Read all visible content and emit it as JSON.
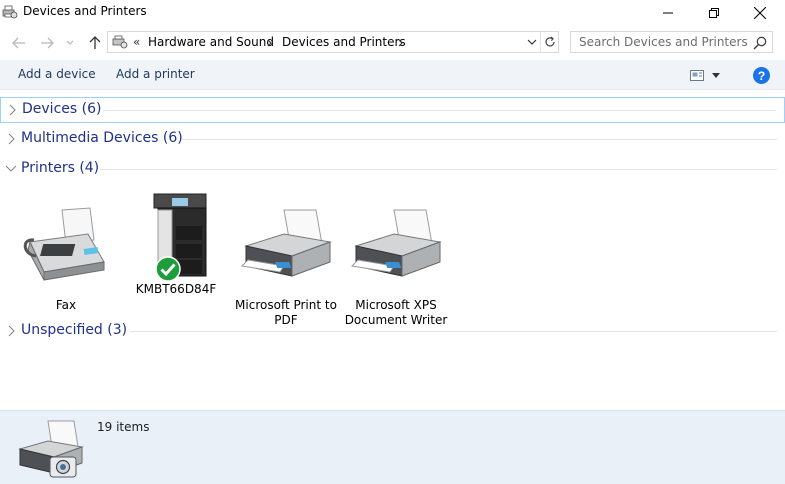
{
  "window": {
    "title": "Devices and Printers",
    "icon": "devices-printers-icon"
  },
  "nav": {
    "crumb_root_chev": "«",
    "breadcrumbs": [
      "Hardware and Sound",
      "Devices and Printers"
    ],
    "search_placeholder": "Search Devices and Printers"
  },
  "toolbar": {
    "add_device": "Add a device",
    "add_printer": "Add a printer",
    "help": "?"
  },
  "groups": {
    "devices": "Devices (6)",
    "multimedia": "Multimedia Devices (6)",
    "printers": "Printers (4)",
    "unspecified": "Unspecified (3)"
  },
  "printers": [
    {
      "name": "Fax",
      "icon": "fax-icon",
      "default": false
    },
    {
      "name": "KMBT66D84F",
      "icon": "multifunction-printer-icon",
      "default": true
    },
    {
      "name": "Microsoft Print to PDF",
      "icon": "printer-icon",
      "default": false
    },
    {
      "name": "Microsoft XPS Document Writer",
      "icon": "printer-icon",
      "default": false
    }
  ],
  "details": {
    "item_count": "19 items"
  },
  "colors": {
    "group_title": "#1e3287",
    "command_text": "#1e395b",
    "command_bar_bg": "#f0f4f9",
    "details_bg": "#e9f0f8",
    "default_check": "#1e9e3a",
    "help_blue": "#1a73e8"
  }
}
